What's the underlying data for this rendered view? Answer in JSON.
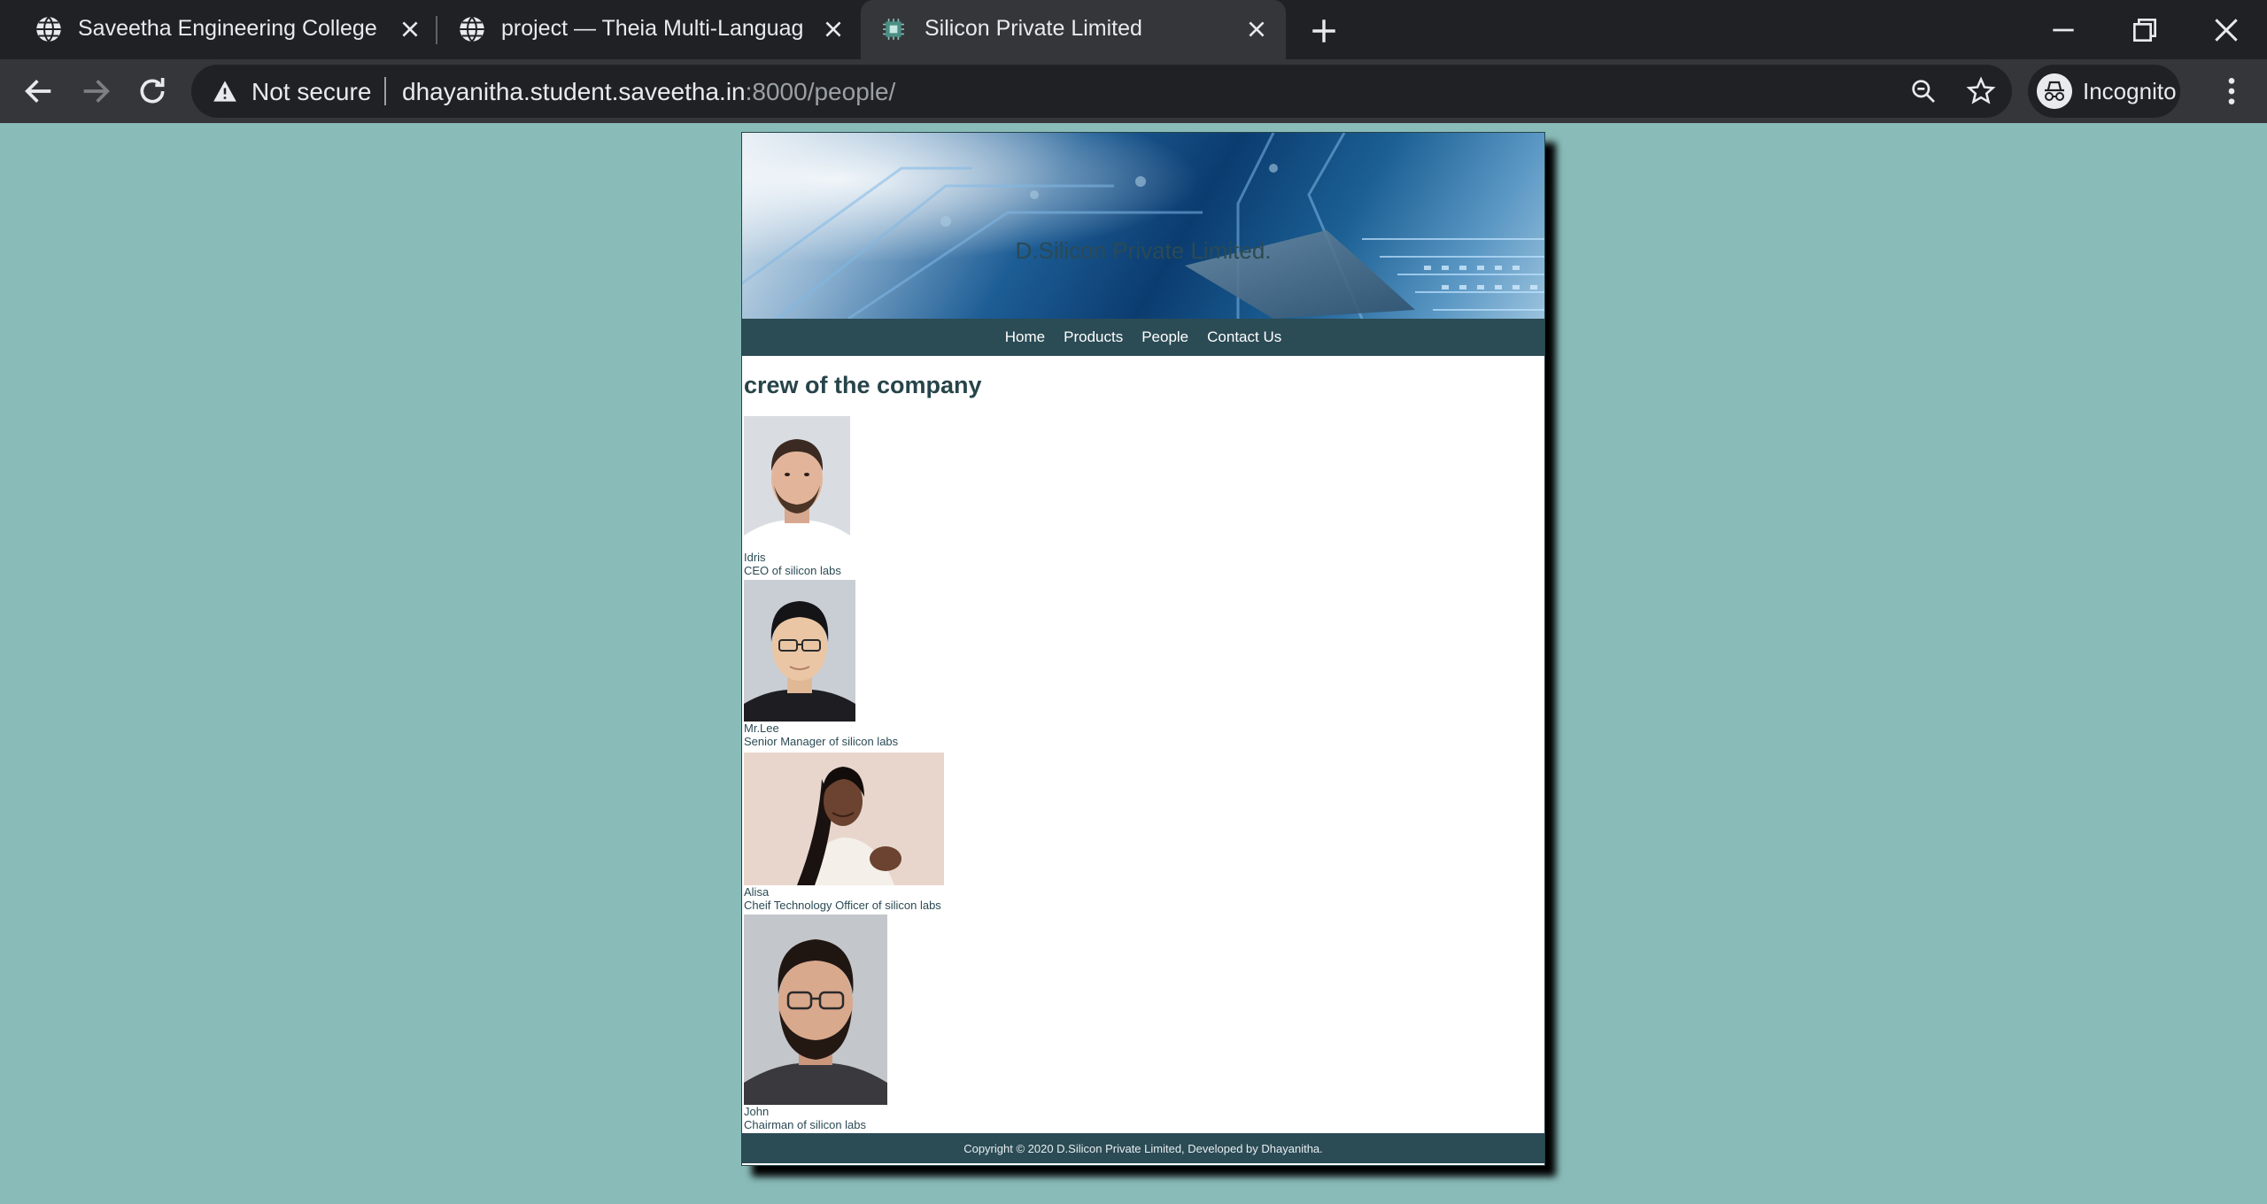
{
  "browser": {
    "tabs": [
      {
        "title": "Saveetha Engineering College",
        "icon": "globe-icon"
      },
      {
        "title": "project — Theia Multi-Language",
        "icon": "globe-icon"
      },
      {
        "title": "Silicon Private Limited",
        "icon": "chip-icon"
      }
    ],
    "security_label": "Not secure",
    "url_host": "dhayanitha.student.saveetha.in",
    "url_rest": ":8000/people/",
    "profile_label": "Incognito"
  },
  "site": {
    "brand": "D.Silicon Private Limited.",
    "nav": [
      "Home",
      "Products",
      "People",
      "Contact Us"
    ],
    "heading": "crew of the company",
    "people": [
      {
        "name": "Idris",
        "role": "CEO of silicon labs"
      },
      {
        "name": "Mr.Lee",
        "role": "Senior Manager of silicon labs"
      },
      {
        "name": "Alisa",
        "role": "Cheif Technology Officer of silicon labs"
      },
      {
        "name": "John",
        "role": "Chairman of silicon labs"
      }
    ],
    "footer": "Copyright © 2020 D.Silicon Private Limited, Developed by Dhayanitha."
  },
  "colors": {
    "page_background": "#89bcb9",
    "site_accent": "#2b4b55",
    "heading_text": "#27444a"
  }
}
